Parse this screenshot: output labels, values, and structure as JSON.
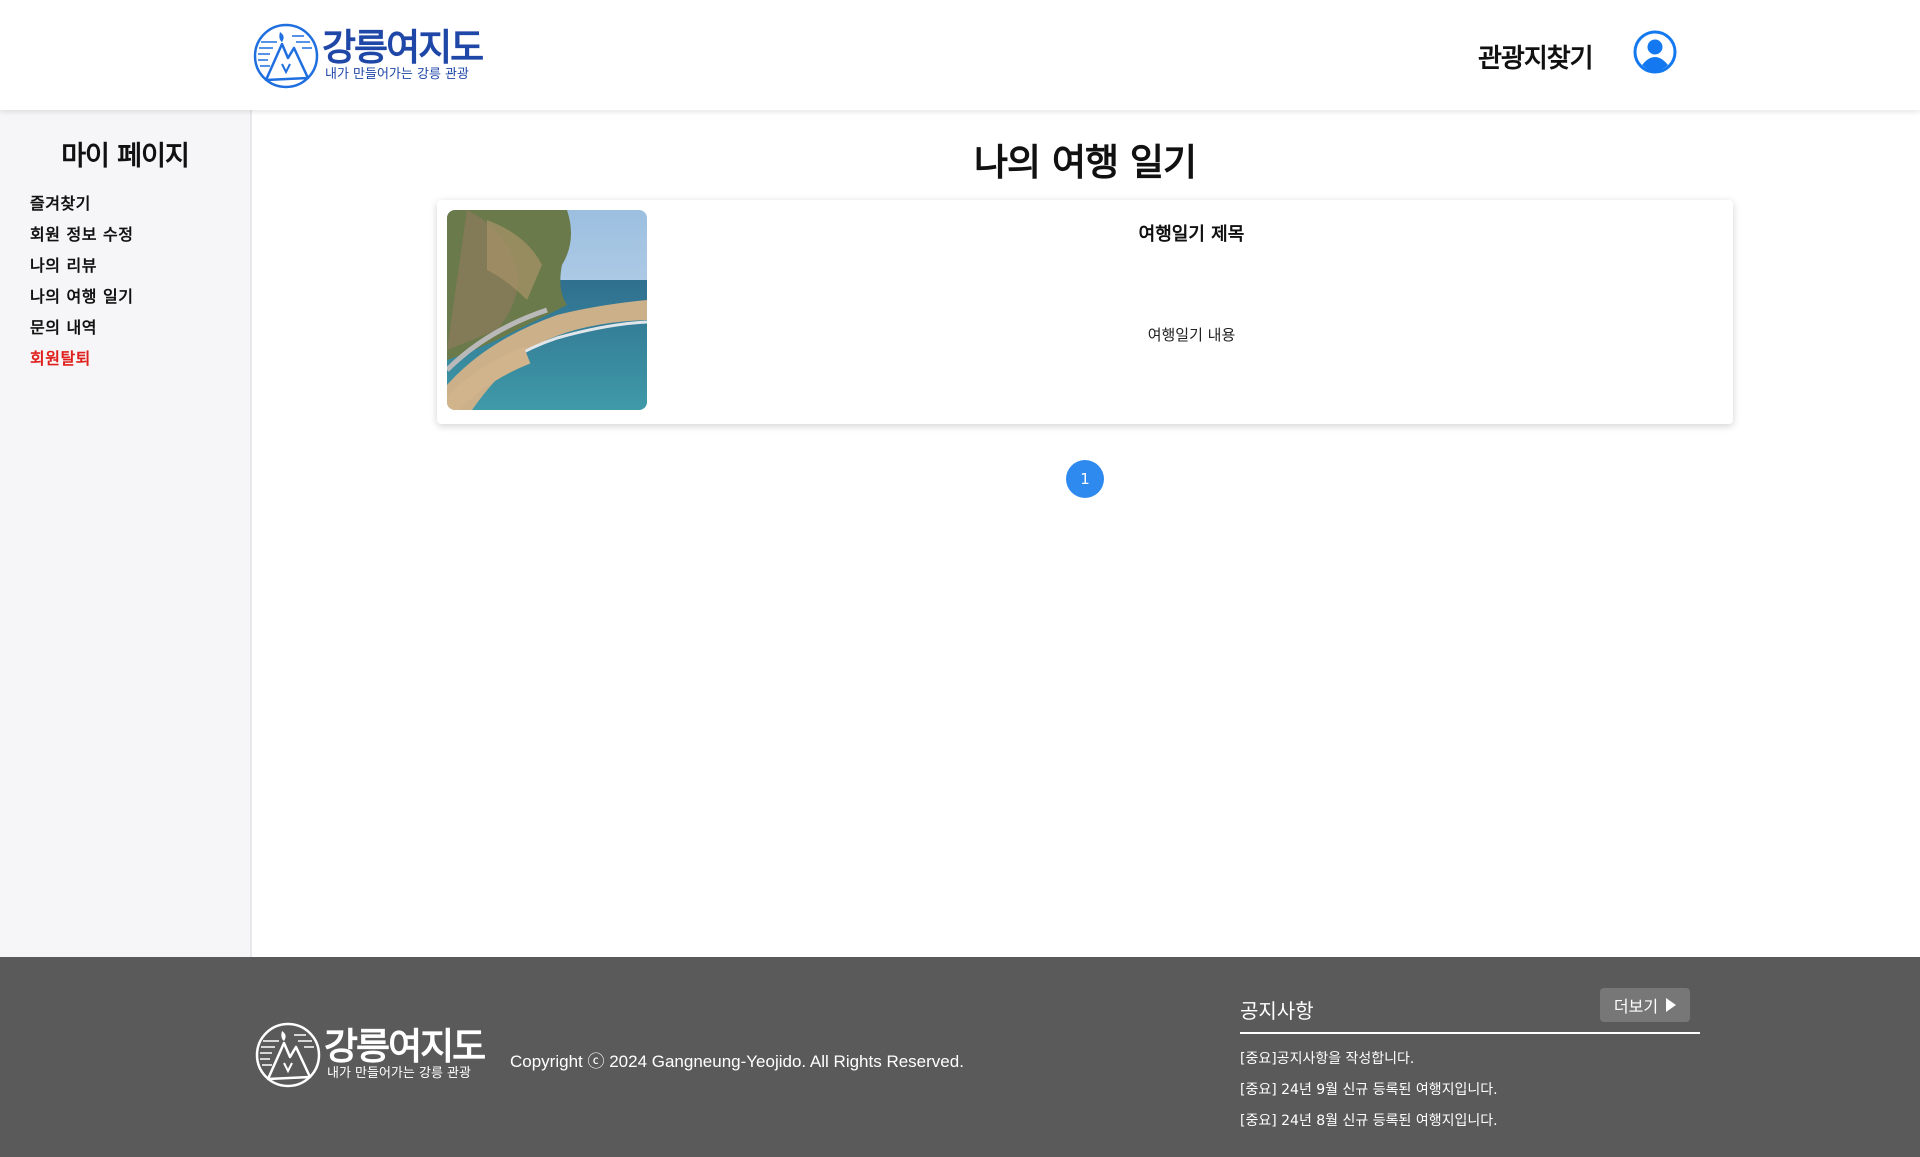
{
  "header": {
    "logo": {
      "title": "강릉여지도",
      "subtitle": "내가 만들어가는 강릉 관광",
      "color": "#1f47a8"
    },
    "nav_link": "관광지찾기",
    "user_icon": "user-circle-icon",
    "accent": "#1479f0"
  },
  "sidebar": {
    "title": "마이 페이지",
    "items": [
      {
        "label": "즐겨찾기"
      },
      {
        "label": "회원 정보 수정"
      },
      {
        "label": "나의 리뷰"
      },
      {
        "label": "나의 여행 일기"
      },
      {
        "label": "문의 내역"
      },
      {
        "label": "회원탈퇴",
        "color": "#e0201c"
      }
    ]
  },
  "main": {
    "title": "나의 여행 일기",
    "diaries": [
      {
        "title": "여행일기 제목",
        "content": "여행일기 내용",
        "image": "coastal-walkway-photo"
      }
    ],
    "pagination": {
      "current": "1",
      "color": "#2f8af0"
    }
  },
  "footer": {
    "logo": {
      "title": "강릉여지도",
      "subtitle": "내가 만들어가는 강릉 관광"
    },
    "copyright": "Copyright ⓒ 2024 Gangneung-Yeojido. All Rights Reserved.",
    "notice": {
      "title": "공지사항",
      "more_label": "더보기",
      "items": [
        "[중요]공지사항을 작성합니다.",
        "[중요] 24년 9월 신규 등록된 여행지입니다.",
        "[중요] 24년 8월 신규 등록된 여행지입니다."
      ]
    },
    "background": "#5a5a5a"
  }
}
